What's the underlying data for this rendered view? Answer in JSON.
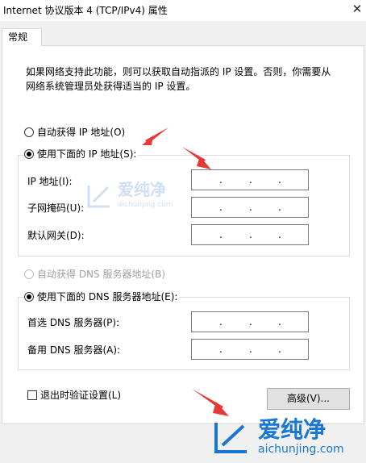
{
  "window": {
    "title": "Internet 协议版本 4 (TCP/IPv4) 属性",
    "close_glyph": "✕"
  },
  "tabs": [
    {
      "label": "常规"
    }
  ],
  "description": "如果网络支持此功能，则可以获取自动指派的 IP 设置。否则，你需要从网络系统管理员处获得适当的 IP 设置。",
  "ip_section": {
    "auto_option": {
      "label": "自动获得 IP 地址(O)",
      "selected": false
    },
    "manual_option": {
      "label": "使用下面的 IP 地址(S):",
      "selected": true
    },
    "fields": [
      {
        "label": "IP 地址(I):",
        "value": ""
      },
      {
        "label": "子网掩码(U):",
        "value": ""
      },
      {
        "label": "默认网关(D):",
        "value": ""
      }
    ]
  },
  "dns_section": {
    "auto_option": {
      "label": "自动获得 DNS 服务器地址(B)",
      "selected": false,
      "disabled": true
    },
    "manual_option": {
      "label": "使用下面的 DNS 服务器地址(E):",
      "selected": true
    },
    "fields": [
      {
        "label": "首选 DNS 服务器(P):",
        "value": ""
      },
      {
        "label": "备用 DNS 服务器(A):",
        "value": ""
      }
    ]
  },
  "validate_on_exit": {
    "label": "退出时验证设置(L)",
    "checked": false
  },
  "advanced_button": {
    "label": "高级(V)..."
  },
  "watermark": {
    "text": "爱纯净",
    "url": "aichunjing.com"
  },
  "colors": {
    "arrow": "#e53935",
    "watermark": "#1976d2",
    "watermark_light": "#cfe0f4"
  }
}
